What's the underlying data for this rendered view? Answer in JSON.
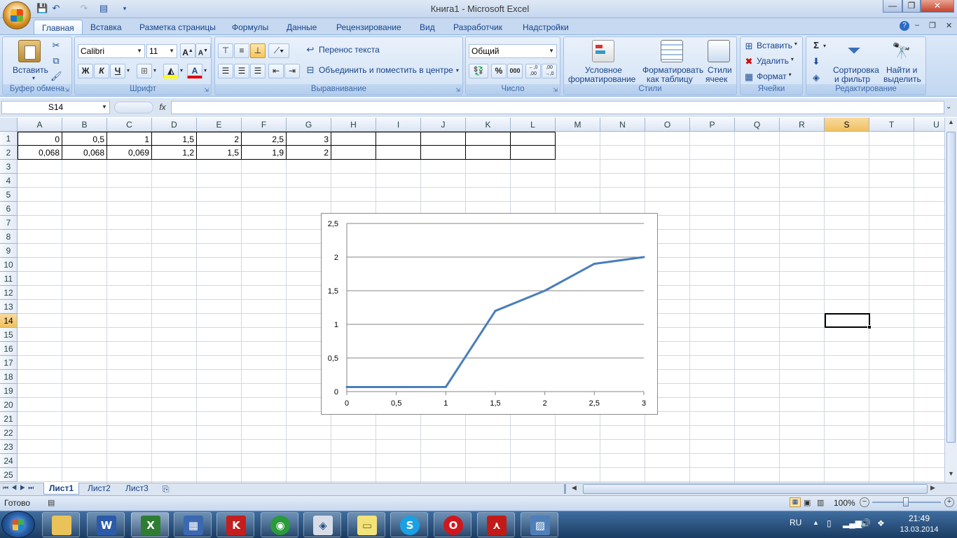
{
  "window": {
    "title": "Книга1 - Microsoft Excel"
  },
  "ribbon_tabs": [
    "Главная",
    "Вставка",
    "Разметка страницы",
    "Формулы",
    "Данные",
    "Рецензирование",
    "Вид",
    "Разработчик",
    "Надстройки"
  ],
  "clipboard": {
    "paste_label": "Вставить",
    "group_label": "Буфер обмена"
  },
  "font": {
    "name": "Calibri",
    "size": "11",
    "bold": "Ж",
    "italic": "К",
    "underline": "Ч",
    "group_label": "Шрифт",
    "grow": "A",
    "shrink": "A",
    "color_letter": "A"
  },
  "alignment": {
    "wrap_label": "Перенос текста",
    "merge_label": "Объединить и поместить в центре",
    "group_label": "Выравнивание"
  },
  "number": {
    "format": "Общий",
    "percent": "%",
    "thousands": "000",
    "inc_decimal": "+,0 ,00",
    "dec_decimal": ",00 →,0",
    "group_label": "Число"
  },
  "styles": {
    "conditional_line1": "Условное",
    "conditional_line2": "форматирование",
    "table_line1": "Форматировать",
    "table_line2": "как таблицу",
    "cell_line1": "Стили",
    "cell_line2": "ячеек",
    "group_label": "Стили"
  },
  "cells": {
    "insert_label": "Вставить",
    "delete_label": "Удалить",
    "format_label": "Формат",
    "group_label": "Ячейки"
  },
  "editing": {
    "sort_line1": "Сортировка",
    "sort_line2": "и фильтр",
    "find_line1": "Найти и",
    "find_line2": "выделить",
    "group_label": "Редактирование",
    "sigma": "Σ"
  },
  "formula_bar": {
    "name_box": "S14",
    "fx": "fx",
    "value": ""
  },
  "columns": [
    "A",
    "B",
    "C",
    "D",
    "E",
    "F",
    "G",
    "H",
    "I",
    "J",
    "K",
    "L",
    "M",
    "N",
    "O",
    "P",
    "Q",
    "R",
    "S",
    "T",
    "U"
  ],
  "rows": [
    "1",
    "2",
    "3",
    "4",
    "5",
    "6",
    "7",
    "8",
    "9",
    "10",
    "11",
    "12",
    "13",
    "14",
    "15",
    "16",
    "17",
    "18",
    "19",
    "20",
    "21",
    "22",
    "23",
    "24",
    "25"
  ],
  "cell_values": {
    "row1": [
      "0",
      "0,5",
      "1",
      "1,5",
      "2",
      "2,5",
      "3"
    ],
    "row2": [
      "0,068",
      "0,068",
      "0,069",
      "1,2",
      "1,5",
      "1,9",
      "2"
    ]
  },
  "chart_data": {
    "type": "line",
    "x": [
      0,
      0.5,
      1,
      1.5,
      2,
      2.5,
      3
    ],
    "series": [
      {
        "values": [
          0.068,
          0.068,
          0.069,
          1.2,
          1.5,
          1.9,
          2
        ]
      }
    ],
    "x_tick_labels": [
      "0",
      "0,5",
      "1",
      "1,5",
      "2",
      "2,5",
      "3"
    ],
    "y_tick_labels": [
      "0",
      "0,5",
      "1",
      "1,5",
      "2",
      "2,5"
    ],
    "ylim": [
      0,
      2.5
    ],
    "xlim": [
      0,
      3
    ],
    "grid": "horizontal",
    "line_color": "#4a7ebb"
  },
  "sheets": [
    "Лист1",
    "Лист2",
    "Лист3"
  ],
  "status": {
    "ready": "Готово",
    "zoom": "100%"
  },
  "taskbar": {
    "lang": "RU",
    "time": "21:49",
    "date": "13.03.2014"
  },
  "colors": {
    "ribbon_bg": "#c9dcf3",
    "selected_header": "#f1c15f",
    "taskbar": "#1b3c63"
  }
}
